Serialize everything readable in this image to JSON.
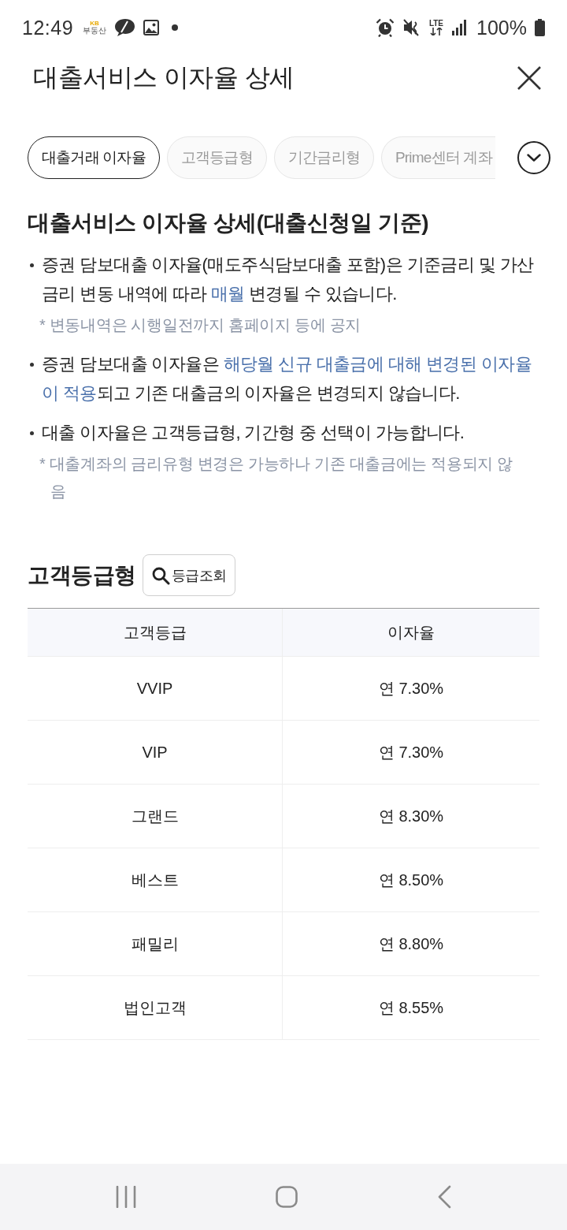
{
  "status_bar": {
    "time": "12:49",
    "app_logo": {
      "top": "KB",
      "bottom": "부동산"
    },
    "network": "LTE",
    "battery": "100%"
  },
  "header": {
    "title": "대출서비스 이자율 상세"
  },
  "tabs": [
    {
      "label": "대출거래 이자율",
      "selected": true
    },
    {
      "label": "고객등급형",
      "selected": false
    },
    {
      "label": "기간금리형",
      "selected": false
    },
    {
      "label": "Prime센터 계좌",
      "selected": false
    }
  ],
  "section": {
    "title": "대출서비스 이자율 상세(대출신청일 기준)",
    "items": [
      {
        "kind": "bullet",
        "parts": [
          {
            "text": "증권 담보대출 이자율(매도주식담보대출 포함)은 기준금리 및 가산금리 변동 내역에 따라 ",
            "highlight": false
          },
          {
            "text": "매월",
            "highlight": true
          },
          {
            "text": " 변경될 수 있습니다.",
            "highlight": false
          }
        ]
      },
      {
        "kind": "note",
        "text": "* 변동내역은 시행일전까지 홈페이지 등에 공지"
      },
      {
        "kind": "bullet",
        "parts": [
          {
            "text": "증권 담보대출 이자율은 ",
            "highlight": false
          },
          {
            "text": "해당월 신규 대출금에 대해 변경된 이자율이 적용",
            "highlight": true
          },
          {
            "text": "되고 기존 대출금의 이자율은 변경되지 않습니다.",
            "highlight": false
          }
        ]
      },
      {
        "kind": "bullet",
        "parts": [
          {
            "text": "대출 이자율은 고객등급형, 기간형 중 선택이 가능합니다.",
            "highlight": false
          }
        ]
      },
      {
        "kind": "note",
        "text": "* 대출계좌의 금리유형 변경은 가능하나 기존 대출금에는 적용되지 않음"
      }
    ]
  },
  "grade_section": {
    "title": "고객등급형",
    "lookup_button": "등급조회",
    "table": {
      "columns": [
        "고객등급",
        "이자율"
      ],
      "rows": [
        [
          "VVIP",
          "연 7.30%"
        ],
        [
          "VIP",
          "연 7.30%"
        ],
        [
          "그랜드",
          "연 8.30%"
        ],
        [
          "베스트",
          "연 8.50%"
        ],
        [
          "패밀리",
          "연 8.80%"
        ],
        [
          "법인고객",
          "연 8.55%"
        ]
      ]
    }
  }
}
